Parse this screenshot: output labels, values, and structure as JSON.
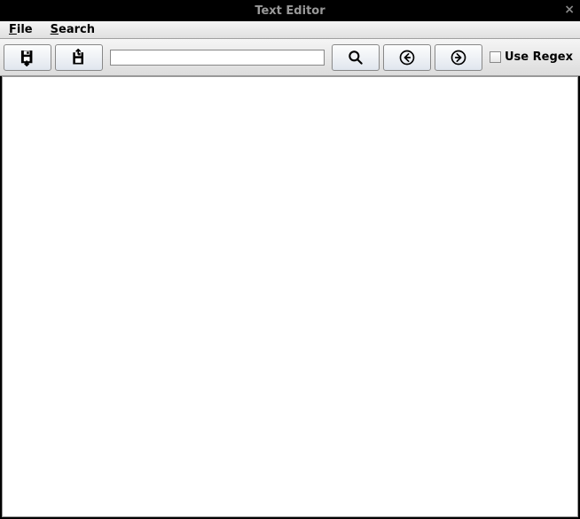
{
  "titlebar": {
    "title": "Text Editor",
    "close_glyph": "×"
  },
  "menubar": {
    "file_mnemonic": "F",
    "file_rest": "ile",
    "search_mnemonic": "S",
    "search_rest": "earch"
  },
  "toolbar": {
    "search_value": "",
    "regex_label": "Use Regex"
  },
  "icons": {
    "save": "save-file-icon",
    "load": "load-file-icon",
    "search": "search-icon",
    "prev": "arrow-left-circle-icon",
    "next": "arrow-right-circle-icon"
  },
  "editor": {
    "content": ""
  }
}
